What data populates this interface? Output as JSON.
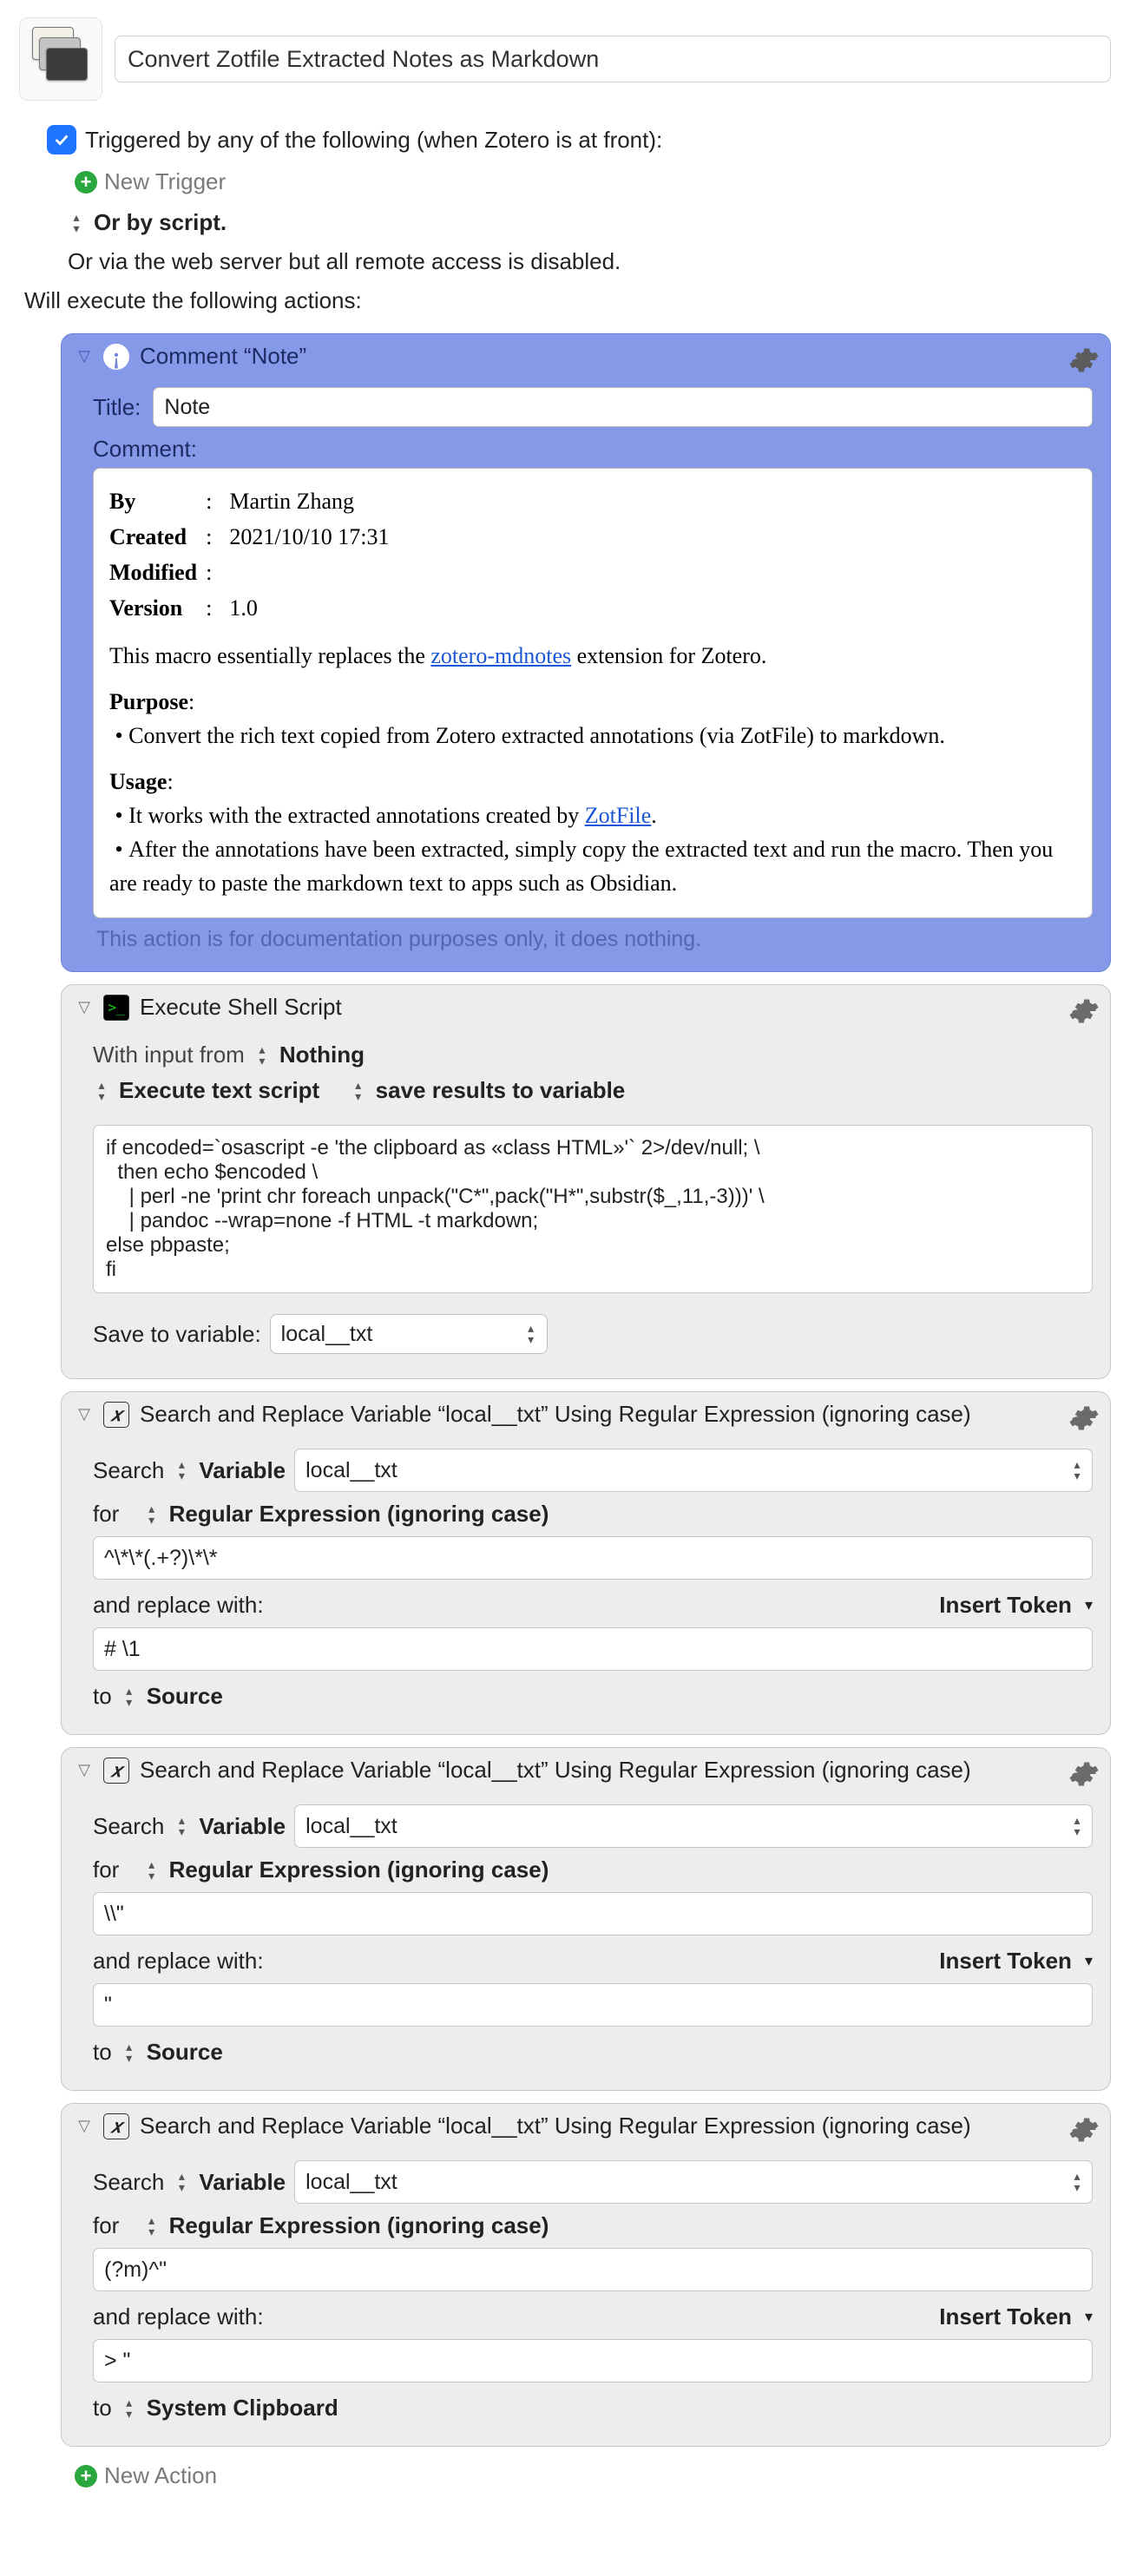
{
  "macro": {
    "name": "Convert Zotfile Extracted Notes as Markdown"
  },
  "trigger": {
    "label": "Triggered by any of the following (when Zotero is at front):",
    "new": "New Trigger",
    "or_by_script": "Or by script.",
    "remote_access": "Or via the web server but all remote access is disabled."
  },
  "actions_label": "Will execute the following actions:",
  "comment": {
    "header": "Comment “Note”",
    "title_label": "Title:",
    "title_value": "Note",
    "comment_label": "Comment:",
    "meta": {
      "by_label": "By",
      "by": "Martin Zhang",
      "created_label": "Created",
      "created": "2021/10/10 17:31",
      "modified_label": "Modified",
      "modified": "",
      "version_label": "Version",
      "version": "1.0"
    },
    "intro_pre": "This macro essentially replaces the ",
    "intro_link": "zotero-mdnotes",
    "intro_post": " extension for Zotero.",
    "purpose_title": "Purpose",
    "purpose_item": "Convert the rich text copied from Zotero extracted annotations (via ZotFile) to markdown.",
    "usage_title": "Usage",
    "usage_item1_pre": "It works with the extracted annotations created by ",
    "usage_item1_link": "ZotFile",
    "usage_item1_post": ".",
    "usage_item2": "After the annotations have been extracted, simply copy the extracted text and run the macro. Then you are ready to paste the markdown text to apps such as Obsidian.",
    "footnote": "This action is for documentation purposes only, it does nothing."
  },
  "shell": {
    "header": "Execute Shell Script",
    "with_input": "With input from",
    "with_input_value": "Nothing",
    "option1": "Execute text script",
    "option2": "save results to variable",
    "script": "if encoded=`osascript -e 'the clipboard as «class HTML»'` 2>/dev/null; \\\n  then echo $encoded \\\n    | perl -ne 'print chr foreach unpack(\"C*\",pack(\"H*\",substr($_,11,-3)))' \\\n    | pandoc --wrap=none -f HTML -t markdown;\nelse pbpaste;\nfi",
    "save_label": "Save to variable:",
    "var": "local__txt"
  },
  "sr_common": {
    "search_label": "Search",
    "variable_label": "Variable",
    "for_label": "for",
    "regex_label": "Regular Expression (ignoring case)",
    "replace_label": "and replace with:",
    "insert_token": "Insert Token",
    "to_label": "to",
    "dest_source": "Source",
    "dest_clipboard": "System Clipboard",
    "header": "Search and Replace Variable “local__txt” Using Regular Expression (ignoring case)",
    "var": "local__txt"
  },
  "sr": [
    {
      "search": "^\\*\\*(.+?)\\*\\*",
      "replace": "# \\1",
      "dest": "Source"
    },
    {
      "search": "\\\\\"",
      "replace": "\"",
      "dest": "Source"
    },
    {
      "search": "(?m)^\"",
      "replace": "> \"",
      "dest": "System Clipboard"
    }
  ],
  "new_action": "New Action"
}
